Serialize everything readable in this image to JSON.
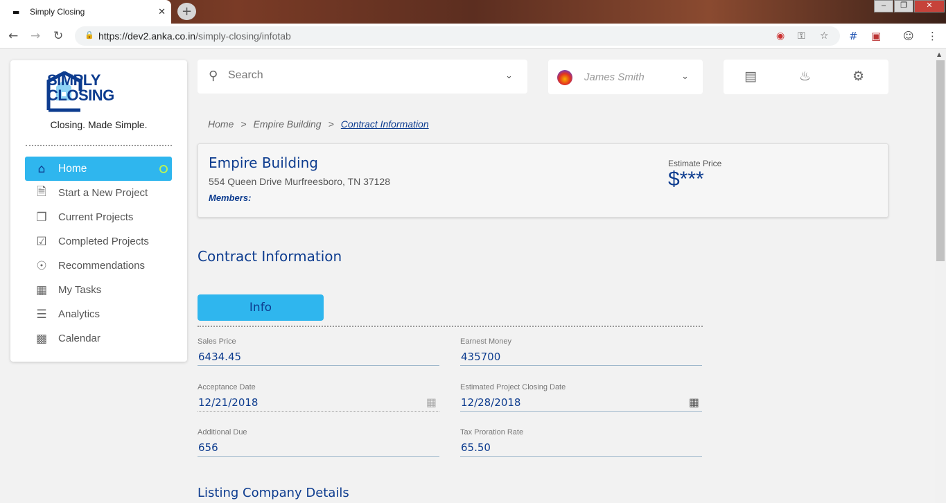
{
  "browser": {
    "tab_title": "Simply Closing",
    "url_host": "https://dev2.anka.co.in",
    "url_path": "/simply-closing/infotab"
  },
  "brand": {
    "name_line1": "SIMPLY",
    "name_line2": "CLOSING",
    "tagline": "Closing.  Made Simple.",
    "primary_color": "#0d3c8f",
    "accent_color": "#2fb6ee"
  },
  "sidebar": {
    "items": [
      {
        "label": "Home",
        "icon": "home-icon",
        "active": true
      },
      {
        "label": "Start a New Project",
        "icon": "file-plus-icon"
      },
      {
        "label": "Current Projects",
        "icon": "files-icon"
      },
      {
        "label": "Completed Projects",
        "icon": "file-check-icon"
      },
      {
        "label": "Recommendations",
        "icon": "award-icon"
      },
      {
        "label": "My Tasks",
        "icon": "calendar-icon"
      },
      {
        "label": "Analytics",
        "icon": "list-icon"
      },
      {
        "label": "Calendar",
        "icon": "calendar-grid-icon"
      }
    ]
  },
  "search": {
    "placeholder": "Search"
  },
  "user": {
    "name": "James Smith"
  },
  "breadcrumb": {
    "home": "Home",
    "sep": ">",
    "project": "Empire Building",
    "current": "Contract Information"
  },
  "project": {
    "title": "Empire Building",
    "address": "554 Queen Drive Murfreesboro, TN 37128",
    "members_label": "Members:",
    "estimate_label": "Estimate Price",
    "estimate_value": "$***"
  },
  "contract": {
    "section_title": "Contract Information",
    "tab_label": "Info",
    "fields": {
      "sales_price": {
        "label": "Sales Price",
        "value": "6434.45"
      },
      "earnest_money": {
        "label": "Earnest Money",
        "value": "435700"
      },
      "acceptance_date": {
        "label": "Acceptance Date",
        "value": "12/21/2018"
      },
      "closing_date": {
        "label": "Estimated Project Closing Date",
        "value": "12/28/2018"
      },
      "additional_due": {
        "label": "Additional Due",
        "value": "656"
      },
      "tax_proration": {
        "label": "Tax Proration Rate",
        "value": "65.50"
      }
    }
  },
  "listing": {
    "section_title": "Listing Company Details"
  }
}
